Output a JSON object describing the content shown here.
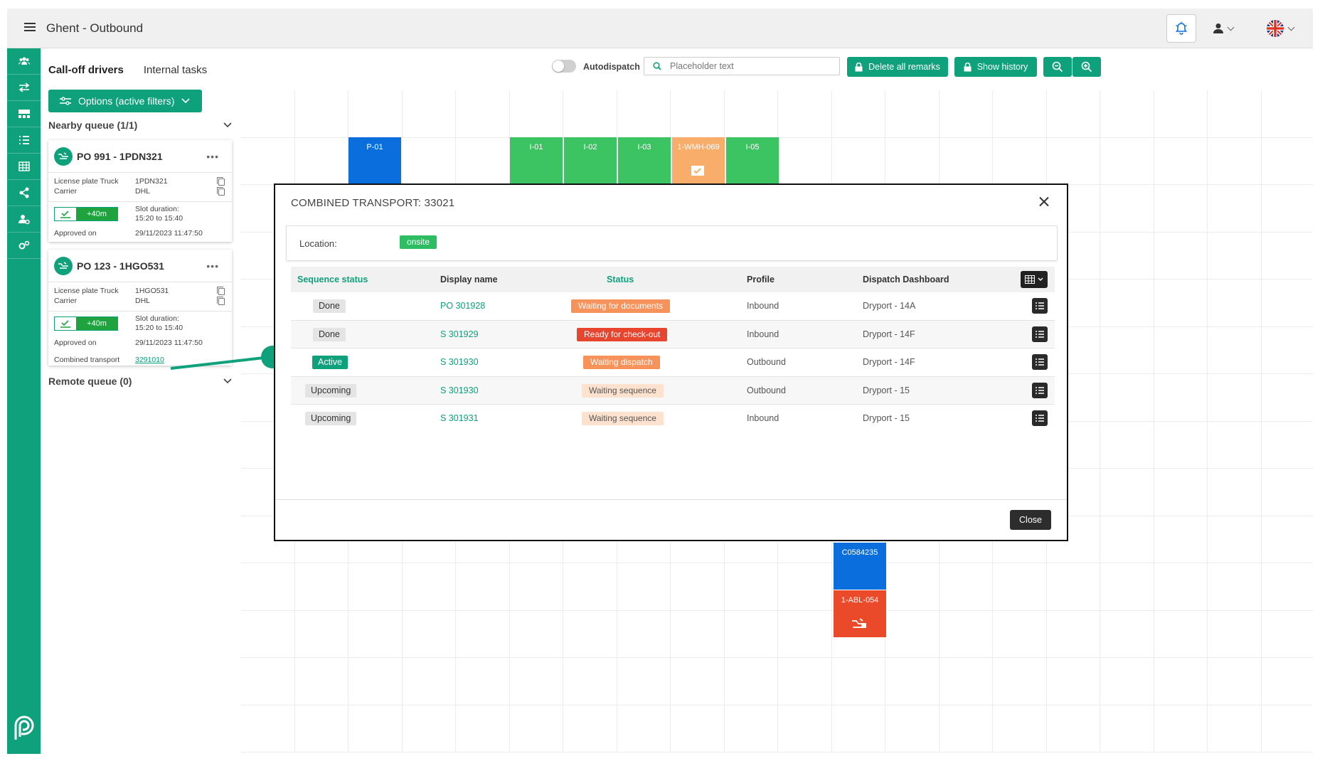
{
  "header": {
    "title": "Ghent - Outbound"
  },
  "tabs": [
    {
      "label": "Call-off drivers"
    },
    {
      "label": "Internal tasks"
    }
  ],
  "options_button": {
    "label": "Options (active filters)"
  },
  "toolbar": {
    "autodispatch_label": "Autodispatch",
    "search_placeholder": "Placeholder text",
    "delete_remarks_label": "Delete all remarks",
    "show_history_label": "Show history"
  },
  "nearby_queue": {
    "label": "Nearby queue (1/1)"
  },
  "remote_queue": {
    "label": "Remote queue (0)"
  },
  "cards": [
    {
      "title": "PO 991 - 1PDN321",
      "license_label": "License plate Truck",
      "license_value": "1PDN321",
      "carrier_label": "Carrier",
      "carrier_value": "DHL",
      "badge": "+40m",
      "slot_label": "Slot duration:",
      "slot_value": "15:20 to 15:40",
      "approved_label": "Approved on",
      "approved_value": "29/11/2023 11:47:50"
    },
    {
      "title": "PO 123 - 1HGO531",
      "license_label": "License plate Truck",
      "license_value": "1HGO531",
      "carrier_label": "Carrier",
      "carrier_value": "DHL",
      "badge": "+40m",
      "slot_label": "Slot duration:",
      "slot_value": "15:20 to 15:40",
      "approved_label": "Approved on",
      "approved_value": "29/11/2023 11:47:50",
      "combined_label": "Combined transport",
      "combined_value": "3291010"
    }
  ],
  "docks": {
    "top": [
      "P-01",
      "I-01",
      "I-02",
      "I-03",
      "1-WMH-069",
      "I-05"
    ],
    "bottom": [
      "C0584235",
      "1-ABL-054"
    ]
  },
  "modal": {
    "title": "COMBINED TRANSPORT: 33021",
    "location_label": "Location:",
    "location_value": "onsite",
    "columns": [
      "Sequence status",
      "Display name",
      "Status",
      "Profile",
      "Dispatch Dashboard"
    ],
    "rows": [
      {
        "seq": "Done",
        "name": "PO 301928",
        "status": "Waiting for documents",
        "profile": "Inbound",
        "dash": "Dryport - 14A"
      },
      {
        "seq": "Done",
        "name": "S 301929",
        "status": "Ready for check-out",
        "profile": "Inbound",
        "dash": "Dryport - 14F"
      },
      {
        "seq": "Active",
        "name": "S 301930",
        "status": "Waiting dispatch",
        "profile": "Outbound",
        "dash": "Dryport - 14F"
      },
      {
        "seq": "Upcoming",
        "name": "S 301930",
        "status": "Waiting sequence",
        "profile": "Outbound",
        "dash": "Dryport - 15"
      },
      {
        "seq": "Upcoming",
        "name": "S 301931",
        "status": "Waiting sequence",
        "profile": "Inbound",
        "dash": "Dryport - 15"
      }
    ],
    "close_label": "Close"
  },
  "colors": {
    "brand": "#0fa07c",
    "dock_blue": "#0a6fdc",
    "dock_green": "#3cc463",
    "dock_orange": "#f9ad6a",
    "dock_red": "#ea4a2a",
    "status_orange": "#f7925b",
    "status_red": "#e8452f",
    "status_light_orange": "#f9c59c"
  },
  "icons": {
    "menu": "hamburger-icon",
    "bell": "alarm-bell-icon",
    "user": "user-icon",
    "flag": "uk-flag-icon"
  }
}
